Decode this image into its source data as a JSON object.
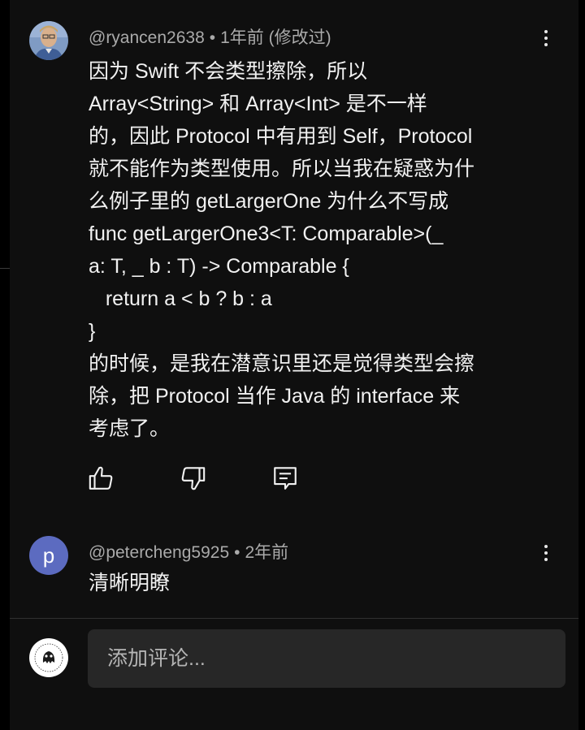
{
  "comments": [
    {
      "handle": "@ryancen2638",
      "separator": "•",
      "time": "1年前 (修改过)",
      "lines": [
        "因为 Swift 不会类型擦除，所以",
        "Array<String> 和 Array<Int> 是不一样",
        "的，因此 Protocol 中有用到 Self，Protocol",
        "就不能作为类型使用。所以当我在疑惑为什",
        "么例子里的 getLargerOne 为什么不写成",
        "func getLargerOne3<T: Comparable>(_",
        "a: T, _ b : T) -> Comparable {",
        "   return a < b ? b : a",
        "}",
        "的时候，是我在潜意识里还是觉得类型会擦",
        "除，把 Protocol 当作 Java 的 interface 来",
        "考虑了。"
      ]
    },
    {
      "avatar_letter": "p",
      "avatar_color": "#5c6bc0",
      "handle": "@petercheng5925",
      "separator": "•",
      "time": "2年前",
      "lines": [
        "清晰明瞭"
      ]
    }
  ],
  "actions": {
    "like_icon": "thumb-up-icon",
    "dislike_icon": "thumb-down-icon",
    "reply_icon": "reply-icon"
  },
  "composer": {
    "placeholder": "添加评论..."
  },
  "colors": {
    "background": "#0f0f0f",
    "meta_text": "#aaaaaa",
    "input_bg": "#272727"
  }
}
